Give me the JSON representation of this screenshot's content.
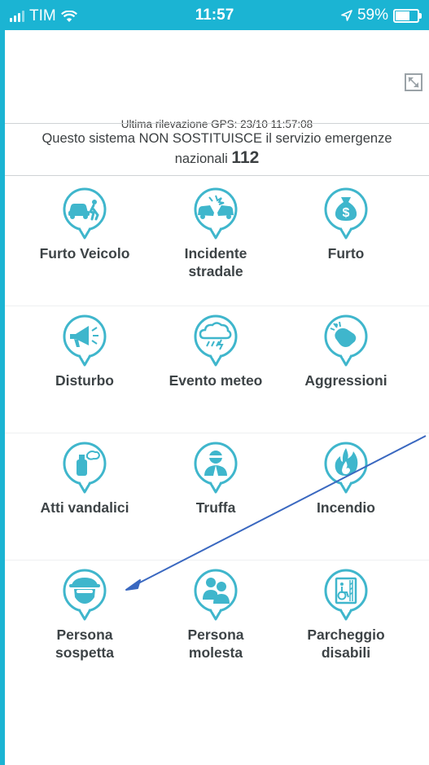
{
  "status_bar": {
    "carrier": "TIM",
    "time": "11:57",
    "battery_percent": "59%",
    "battery_level": 0.59
  },
  "gps": {
    "text": "Ultima rilevazione GPS:  23/10 11:57:08"
  },
  "notice": {
    "text": "Questo sistema NON SOSTITUISCE il servizio emergenze nazionali",
    "number": "112"
  },
  "categories": [
    {
      "label": "Furto Veicolo",
      "icon": "car-theft-icon"
    },
    {
      "label": "Incidente stradale",
      "icon": "car-crash-icon"
    },
    {
      "label": "Furto",
      "icon": "money-bag-icon"
    },
    {
      "label": "Disturbo",
      "icon": "megaphone-icon"
    },
    {
      "label": "Evento meteo",
      "icon": "storm-cloud-icon"
    },
    {
      "label": "Aggressioni",
      "icon": "fist-icon"
    },
    {
      "label": "Atti vandalici",
      "icon": "spray-can-icon"
    },
    {
      "label": "Truffa",
      "icon": "masked-person-icon"
    },
    {
      "label": "Incendio",
      "icon": "fire-icon"
    },
    {
      "label": "Persona sospetta",
      "icon": "suspicious-person-icon"
    },
    {
      "label": "Persona molesta",
      "icon": "people-icon"
    },
    {
      "label": "Parcheggio disabili",
      "icon": "disabled-parking-icon"
    }
  ],
  "colors": {
    "accent": "#3FB6CC",
    "frame": "#1BB4D3",
    "annotation_arrow": "#3A68C0"
  }
}
